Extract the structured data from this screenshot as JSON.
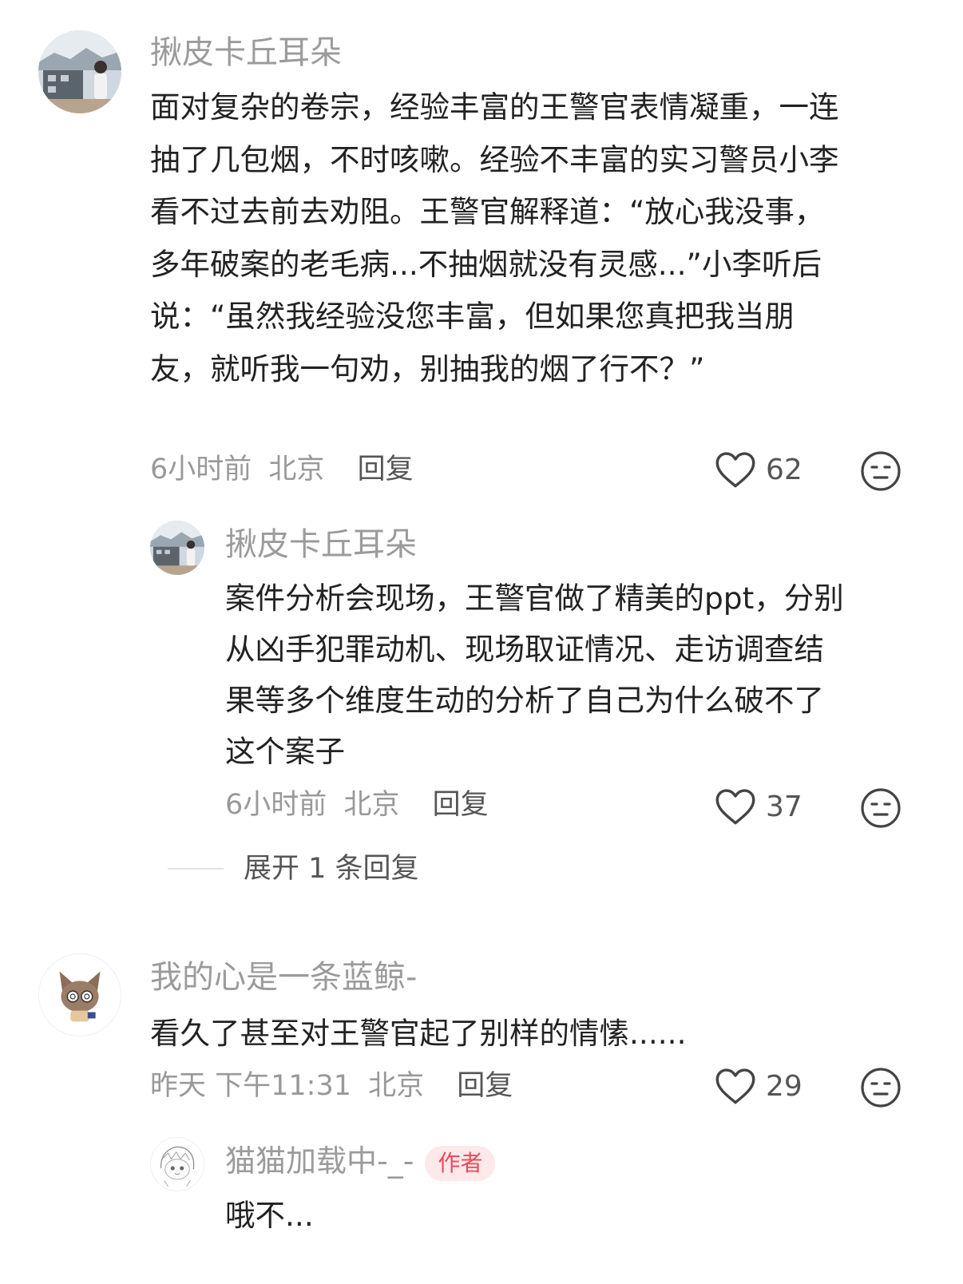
{
  "comments": [
    {
      "username": "揪皮卡丘耳朵",
      "lines": [
        "面对复杂的卷宗，经验丰富的王警官表情凝重，一连",
        "抽了几包烟，不时咳嗽。经验不丰富的实习警员小李",
        "看不过去前去劝阻。王警官解释道：“放心我没事，",
        "多年破案的老毛病...不抽烟就没有灵感...”小李听后",
        "说：“虽然我经验没您丰富，但如果您真把我当朋",
        "友，就听我一句劝，别抽我的烟了行不？”"
      ],
      "time": "6小时前",
      "location": "北京",
      "reply_label": "回复",
      "likes": "62",
      "replies": [
        {
          "username": "揪皮卡丘耳朵",
          "lines": [
            "案件分析会现场，王警官做了精美的ppt，分别",
            "从凶手犯罪动机、现场取证情况、走访调查结",
            "果等多个维度生动的分析了自己为什么破不了",
            "这个案子"
          ],
          "time": "6小时前",
          "location": "北京",
          "reply_label": "回复",
          "likes": "37"
        }
      ],
      "expand_label": "展开 1 条回复"
    },
    {
      "username": "我的心是一条蓝鲸-",
      "lines": [
        "看久了甚至对王警官起了别样的情愫......"
      ],
      "time": "昨天 下午11:31",
      "location": "北京",
      "reply_label": "回复",
      "likes": "29",
      "replies": [
        {
          "username": "猫猫加载中-_-",
          "badge": "作者",
          "lines": [
            "哦不..."
          ]
        }
      ]
    }
  ],
  "icons": {
    "like": "heart-outline-icon",
    "dislike": "neutral-face-icon"
  },
  "colors": {
    "username": "#9b9b9b",
    "badge_bg": "#fde8ea",
    "badge_text": "#ea4a5a"
  }
}
